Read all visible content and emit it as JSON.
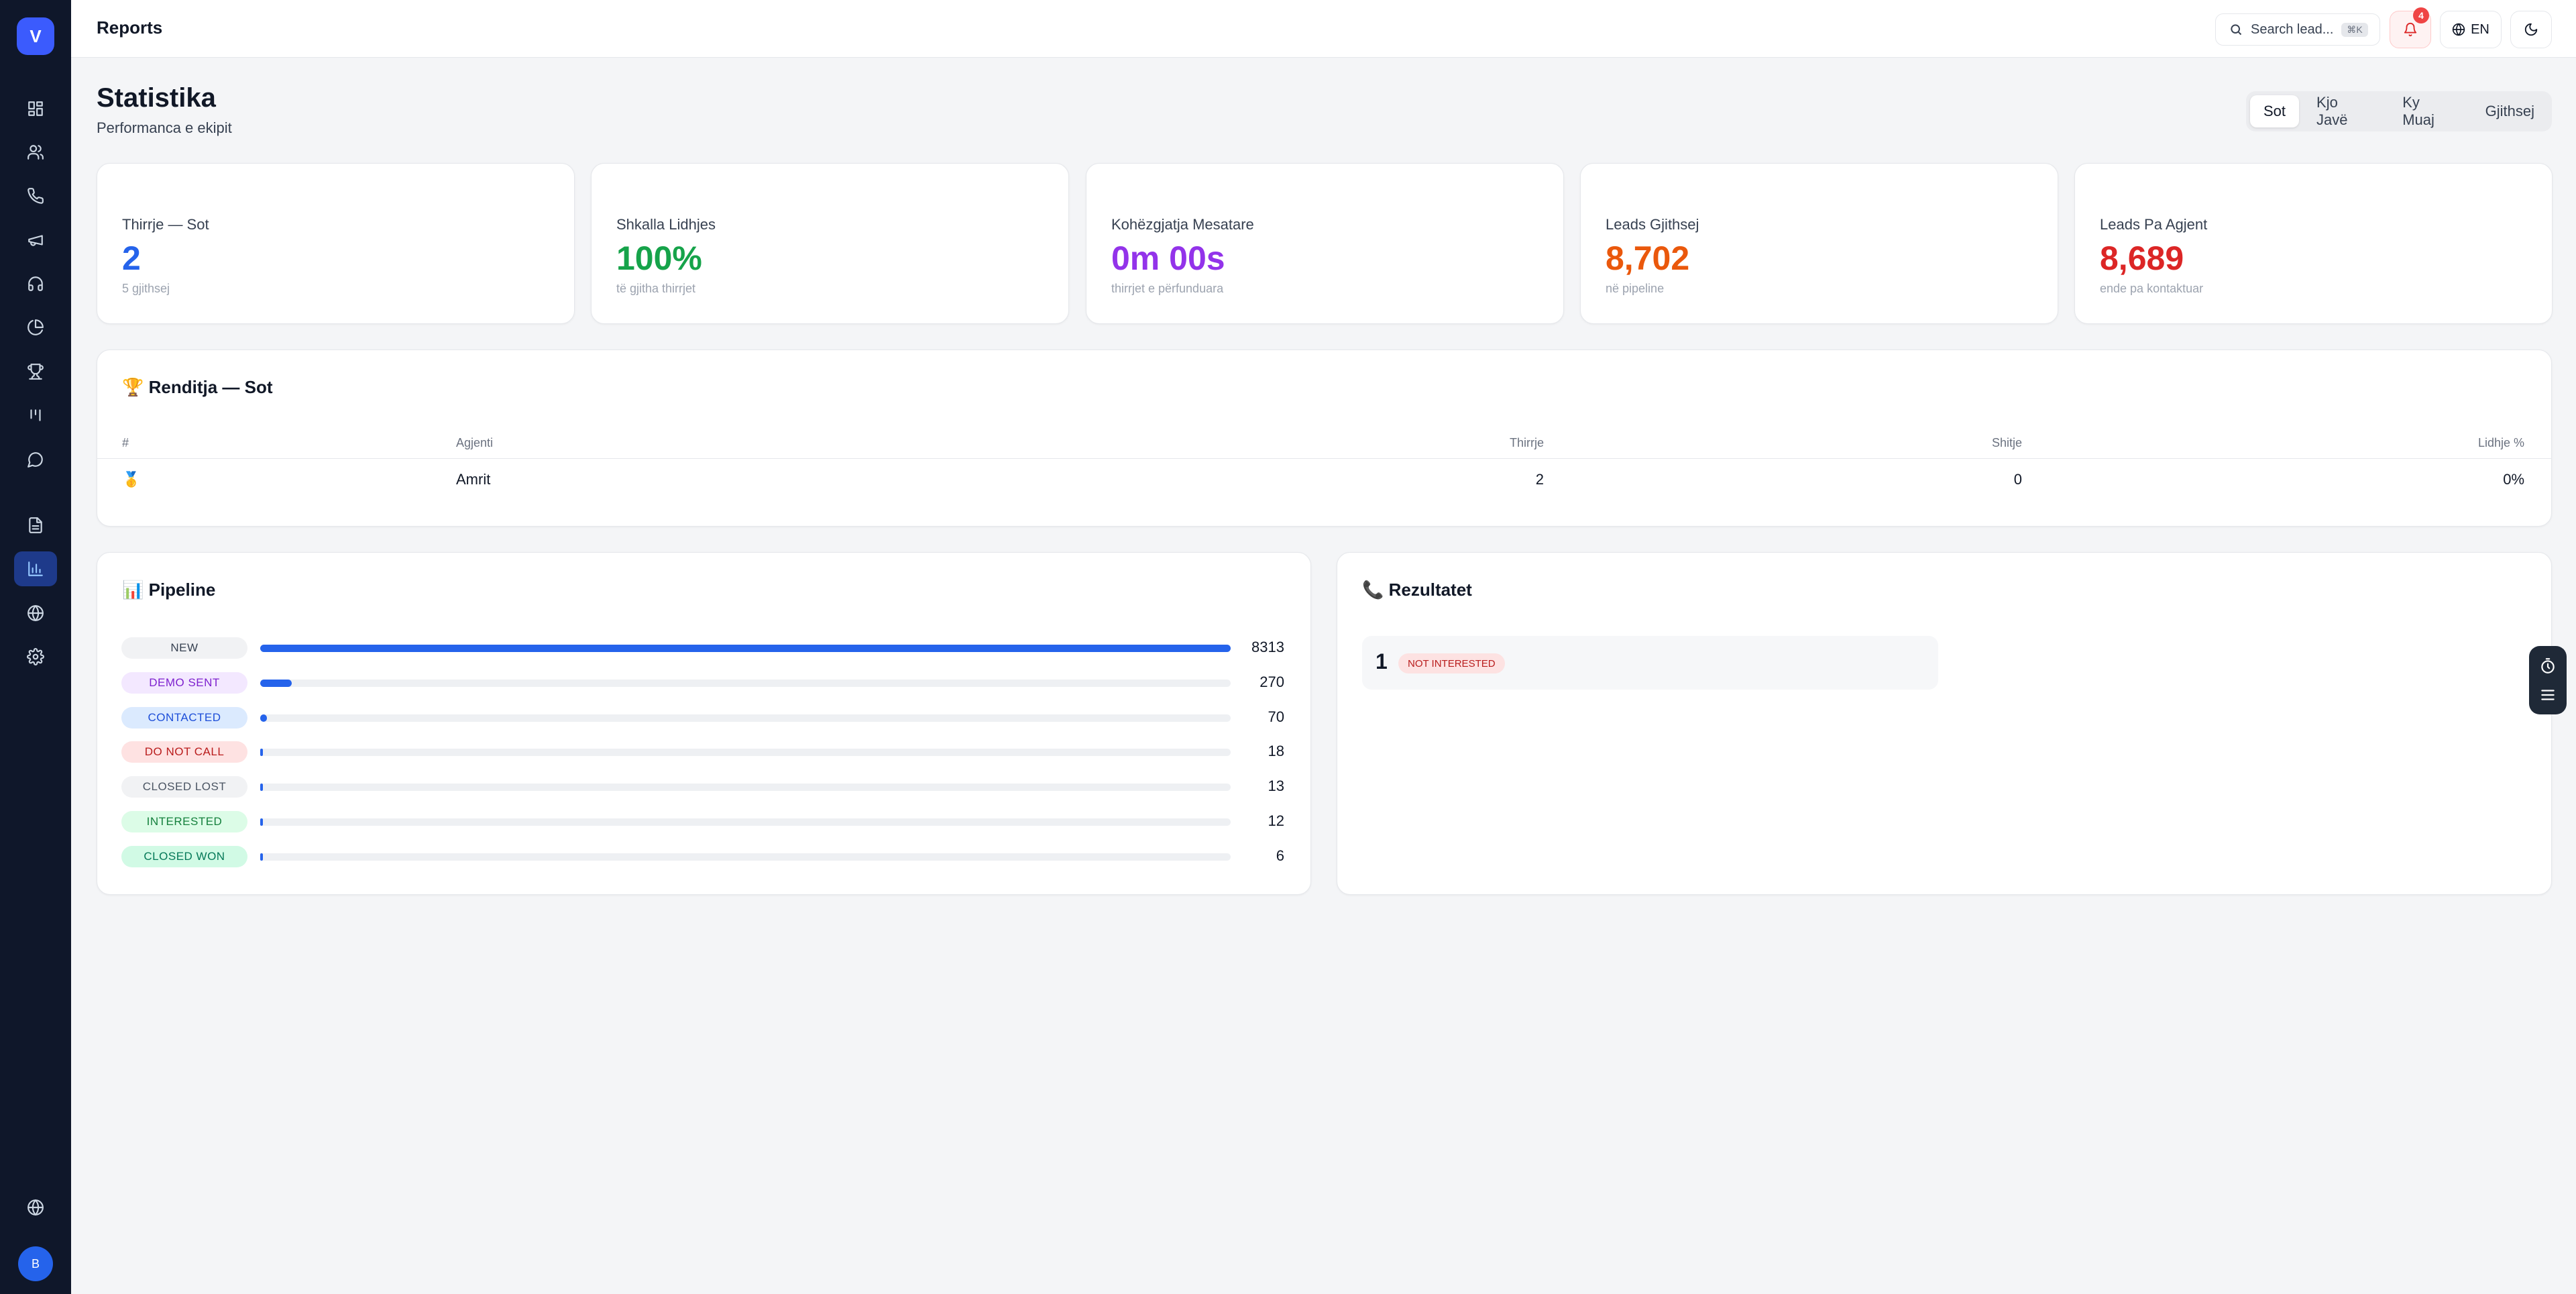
{
  "sidebar": {
    "logo_letter": "V",
    "avatar_letter": "B"
  },
  "topbar": {
    "title": "Reports",
    "search_placeholder": "Search lead...",
    "search_shortcut": "⌘K",
    "notification_count": "4",
    "language": "EN"
  },
  "header": {
    "title": "Statistika",
    "subtitle": "Performanca e ekipit",
    "periods": [
      "Sot",
      "Kjo Javë",
      "Ky Muaj",
      "Gjithsej"
    ],
    "active_period": "Sot"
  },
  "stats": [
    {
      "label": "Thirrje — Sot",
      "value": "2",
      "foot": "5 gjithsej",
      "color": "#2563eb"
    },
    {
      "label": "Shkalla Lidhjes",
      "value": "100%",
      "foot": "të gjitha thirrjet",
      "color": "#16a34a"
    },
    {
      "label": "Kohëzgjatja Mesatare",
      "value": "0m 00s",
      "foot": "thirrjet e përfunduara",
      "color": "#9333ea"
    },
    {
      "label": "Leads Gjithsej",
      "value": "8,702",
      "foot": "në pipeline",
      "color": "#ea580c"
    },
    {
      "label": "Leads Pa Agjent",
      "value": "8,689",
      "foot": "ende pa kontaktuar",
      "color": "#dc2626"
    }
  ],
  "ranking": {
    "title": "🏆 Renditja — Sot",
    "columns": [
      "#",
      "Agjenti",
      "Thirrje",
      "Shitje",
      "Lidhje %"
    ],
    "rows": [
      {
        "rank": "🥇",
        "agent": "Amrit",
        "calls": "2",
        "sales": "0",
        "rate": "0%"
      }
    ]
  },
  "pipeline": {
    "title": "📊 Pipeline",
    "max": 8313,
    "rows": [
      {
        "label": "NEW",
        "count": 8313,
        "bg": "#f1f2f4",
        "fg": "#374151"
      },
      {
        "label": "DEMO SENT",
        "count": 270,
        "bg": "#f3e8ff",
        "fg": "#7e22ce"
      },
      {
        "label": "CONTACTED",
        "count": 70,
        "bg": "#dbeafe",
        "fg": "#1d4ed8"
      },
      {
        "label": "DO NOT CALL",
        "count": 18,
        "bg": "#fee2e2",
        "fg": "#b91c1c"
      },
      {
        "label": "CLOSED LOST",
        "count": 13,
        "bg": "#f1f2f4",
        "fg": "#4b5563"
      },
      {
        "label": "INTERESTED",
        "count": 12,
        "bg": "#dcfce7",
        "fg": "#15803d"
      },
      {
        "label": "CLOSED WON",
        "count": 6,
        "bg": "#d1fae5",
        "fg": "#047857"
      }
    ]
  },
  "results": {
    "title": "📞 Rezultatet",
    "items": [
      {
        "count": "1",
        "label": "NOT INTERESTED"
      }
    ]
  }
}
